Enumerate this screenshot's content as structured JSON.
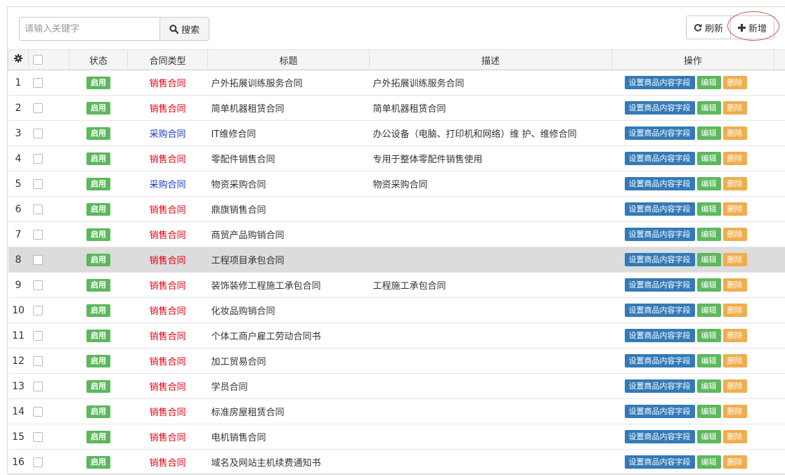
{
  "toolbar": {
    "search_placeholder": "请输入关键字",
    "search_label": "搜索",
    "refresh_label": "刷新",
    "add_label": "新增"
  },
  "table": {
    "columns": [
      "状态",
      "合同类型",
      "标题",
      "描述",
      "操作"
    ],
    "actions": {
      "fields": "设置商品内容字段",
      "edit": "编辑",
      "delete": "删除"
    },
    "rows": [
      {
        "num": "1",
        "status": "启用",
        "type": "销售合同",
        "kind": "sell",
        "title": "户外拓展训练服务合同",
        "desc": "户外拓展训练服务合同"
      },
      {
        "num": "2",
        "status": "启用",
        "type": "销售合同",
        "kind": "sell",
        "title": "简单机器租赁合同",
        "desc": "简单机器租赁合同"
      },
      {
        "num": "3",
        "status": "启用",
        "type": "采购合同",
        "kind": "buy",
        "title": "IT维修合同",
        "desc": "办公设备（电脑、打印机和网络）维 护、维修合同"
      },
      {
        "num": "4",
        "status": "启用",
        "type": "销售合同",
        "kind": "sell",
        "title": "零配件销售合同",
        "desc": "专用于整体零配件销售使用"
      },
      {
        "num": "5",
        "status": "启用",
        "type": "采购合同",
        "kind": "buy",
        "title": "物资采购合同",
        "desc": "物资采购合同"
      },
      {
        "num": "6",
        "status": "启用",
        "type": "销售合同",
        "kind": "sell",
        "title": "鼎旗销售合同",
        "desc": ""
      },
      {
        "num": "7",
        "status": "启用",
        "type": "销售合同",
        "kind": "sell",
        "title": "商贸产品购销合同",
        "desc": ""
      },
      {
        "num": "8",
        "status": "启用",
        "type": "销售合同",
        "kind": "sell",
        "title": "工程项目承包合同",
        "desc": "",
        "highlight": true
      },
      {
        "num": "9",
        "status": "启用",
        "type": "销售合同",
        "kind": "sell",
        "title": "装饰装修工程施工承包合同",
        "desc": "工程施工承包合同"
      },
      {
        "num": "10",
        "status": "启用",
        "type": "销售合同",
        "kind": "sell",
        "title": "化妆品购销合同",
        "desc": ""
      },
      {
        "num": "11",
        "status": "启用",
        "type": "销售合同",
        "kind": "sell",
        "title": "个体工商户雇工劳动合同书",
        "desc": ""
      },
      {
        "num": "12",
        "status": "启用",
        "type": "销售合同",
        "kind": "sell",
        "title": "加工贸易合同",
        "desc": ""
      },
      {
        "num": "13",
        "status": "启用",
        "type": "销售合同",
        "kind": "sell",
        "title": "学员合同",
        "desc": ""
      },
      {
        "num": "14",
        "status": "启用",
        "type": "销售合同",
        "kind": "sell",
        "title": "标准房屋租赁合同",
        "desc": ""
      },
      {
        "num": "15",
        "status": "启用",
        "type": "销售合同",
        "kind": "sell",
        "title": "电机销售合同",
        "desc": ""
      },
      {
        "num": "16",
        "status": "启用",
        "type": "销售合同",
        "kind": "sell",
        "title": "域名及网站主机续费通知书",
        "desc": ""
      }
    ]
  },
  "colors": {
    "status_green": "#5cb85c",
    "sell_red": "#e60012",
    "buy_blue": "#1a3cc8",
    "action_blue": "#337ab7",
    "action_yellow": "#f0ad4e",
    "annotation_red": "#d9534f"
  },
  "icons": [
    "gear-icon",
    "search-icon",
    "refresh-icon",
    "plus-icon"
  ]
}
